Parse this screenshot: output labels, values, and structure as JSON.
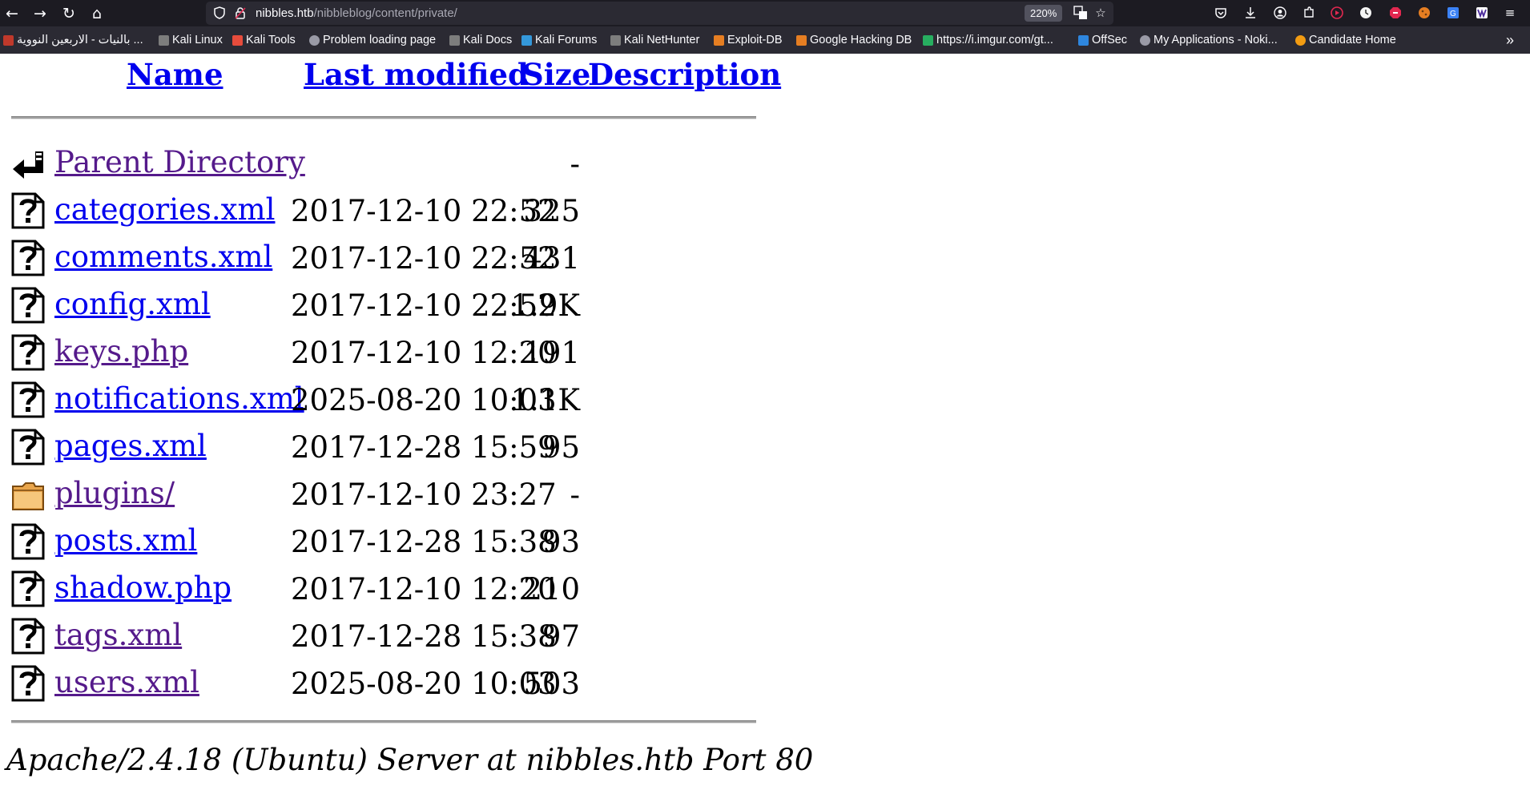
{
  "browser": {
    "url_host": "nibbles.htb",
    "url_path": "/nibbleblog/content/private/",
    "zoom": "220%",
    "bookmarks": [
      {
        "label": "بالنيات - الاربعين النووية ...",
        "color": "#c0392b"
      },
      {
        "label": "Kali Linux",
        "color": "#7d7d7d"
      },
      {
        "label": "Kali Tools",
        "color": "#e74c3c"
      },
      {
        "label": "Problem loading page",
        "color": "#9a9aa6"
      },
      {
        "label": "Kali Docs",
        "color": "#7d7d7d"
      },
      {
        "label": "Kali Forums",
        "color": "#3498db"
      },
      {
        "label": "Kali NetHunter",
        "color": "#7d7d7d"
      },
      {
        "label": "Exploit-DB",
        "color": "#e67e22"
      },
      {
        "label": "Google Hacking DB",
        "color": "#e67e22"
      },
      {
        "label": "https://i.imgur.com/gt...",
        "color": "#27ae60"
      },
      {
        "label": "OffSec",
        "color": "#2e86de"
      },
      {
        "label": "My Applications - Noki...",
        "color": "#9a9aa6"
      },
      {
        "label": "Candidate Home",
        "color": "#f39c12"
      }
    ]
  },
  "listing": {
    "headers": {
      "name": "Name",
      "last_modified": "Last modified",
      "size": "Size",
      "description": "Description"
    },
    "rows": [
      {
        "name": "Parent Directory",
        "date": "",
        "size": "-",
        "icon": "back-arrow-icon",
        "visited": true
      },
      {
        "name": "categories.xml",
        "date": "2017-12-10 22:52",
        "size": "325",
        "icon": "unknown-file-icon",
        "visited": false
      },
      {
        "name": "comments.xml",
        "date": "2017-12-10 22:52",
        "size": "431",
        "icon": "unknown-file-icon",
        "visited": false
      },
      {
        "name": "config.xml",
        "date": "2017-12-10 22:52",
        "size": "1.9K",
        "icon": "unknown-file-icon",
        "visited": false
      },
      {
        "name": "keys.php",
        "date": "2017-12-10 12:20",
        "size": "191",
        "icon": "unknown-file-icon",
        "visited": true
      },
      {
        "name": "notifications.xml",
        "date": "2025-08-20 10:03",
        "size": "1.1K",
        "icon": "unknown-file-icon",
        "visited": false
      },
      {
        "name": "pages.xml",
        "date": "2017-12-28 15:59",
        "size": "95",
        "icon": "unknown-file-icon",
        "visited": false
      },
      {
        "name": "plugins/",
        "date": "2017-12-10 23:27",
        "size": "-",
        "icon": "folder-icon",
        "visited": true
      },
      {
        "name": "posts.xml",
        "date": "2017-12-28 15:38",
        "size": "93",
        "icon": "unknown-file-icon",
        "visited": false
      },
      {
        "name": "shadow.php",
        "date": "2017-12-10 12:20",
        "size": "210",
        "icon": "unknown-file-icon",
        "visited": false
      },
      {
        "name": "tags.xml",
        "date": "2017-12-28 15:38",
        "size": "97",
        "icon": "unknown-file-icon",
        "visited": true
      },
      {
        "name": "users.xml",
        "date": "2025-08-20 10:03",
        "size": "503",
        "icon": "unknown-file-icon",
        "visited": true
      }
    ]
  },
  "footer": "Apache/2.4.18 (Ubuntu) Server at nibbles.htb Port 80"
}
